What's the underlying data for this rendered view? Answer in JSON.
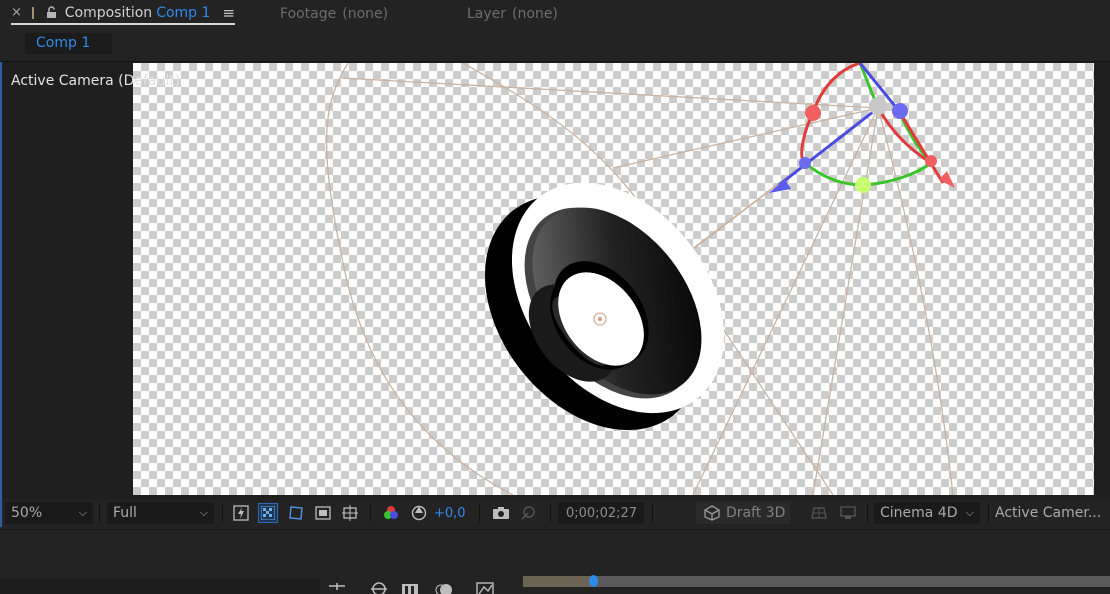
{
  "tabs": {
    "composition": {
      "close": "×",
      "label": "Composition",
      "name": "Comp 1",
      "menu": "≡"
    },
    "footage": {
      "label": "Footage",
      "value": "(none)"
    },
    "layer": {
      "label": "Layer",
      "value": "(none)"
    }
  },
  "comp_chip": "Comp 1",
  "viewer": {
    "camera_label": "Active Camera (Default)"
  },
  "toolbar": {
    "zoom": "50%",
    "resolution": "Full",
    "exposure": "+0,0",
    "timecode": "0;00;02;27",
    "draft3d": "Draft 3D",
    "renderer": "Cinema 4D",
    "view": "Active Camer..."
  },
  "colors": {
    "accent": "#2d8ceb",
    "gizmo_x": "#e03a3a",
    "gizmo_y": "#39c42a",
    "gizmo_z": "#4b4be0",
    "camera_lines": "#c8b3a0"
  },
  "timeline": {
    "playhead_fraction": 0.12
  }
}
